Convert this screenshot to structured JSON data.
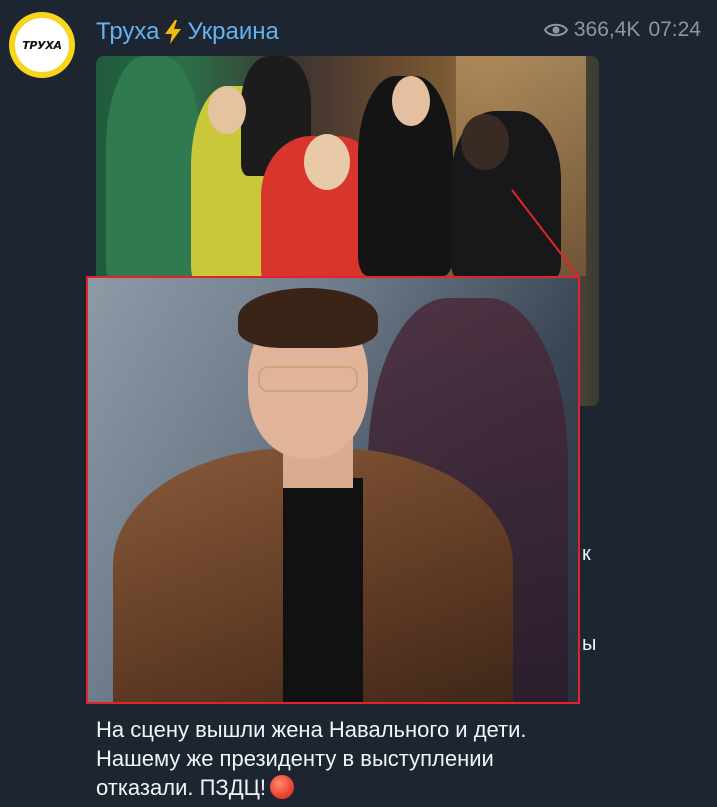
{
  "channel": {
    "name_part1": "Труха",
    "name_part2": "Украина",
    "avatar_text": "ТРУХА"
  },
  "meta": {
    "views": "366,4K",
    "time": "07:24"
  },
  "caption": {
    "line1": "На сцену вышли жена Навального и дети.",
    "line2": "Нашему же президенту в выступлении",
    "line3": "отказали. ПЗДЦ!"
  },
  "partial_text": {
    "fragment1": "к",
    "fragment2": "ы"
  },
  "colors": {
    "background": "#1c2530",
    "channel_name": "#64b3f0",
    "meta": "#8d97a2",
    "highlight": "#e2232b",
    "text": "#f2f4f6"
  },
  "icons": {
    "bolt": "lightning-bolt-emoji",
    "eye": "eye-icon",
    "angry": "angry-face-emoji"
  }
}
